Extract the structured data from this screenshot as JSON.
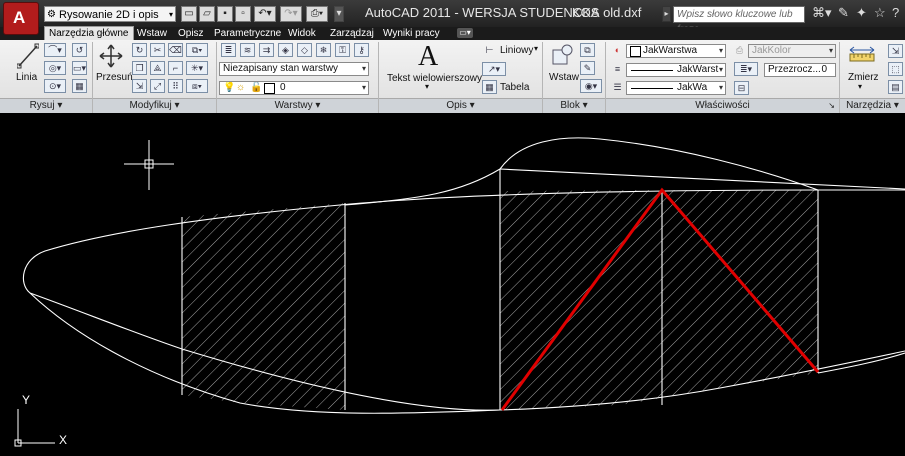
{
  "title": {
    "app": "AutoCAD 2011 - WERSJA STUDENCKA",
    "file": "KOS old.dxf"
  },
  "workspace": {
    "value": "Rysowanie 2D i opis"
  },
  "search": {
    "placeholder": "Wpisz słowo kluczowe lub frazę"
  },
  "tabs": [
    "Narzędzia główne",
    "Wstaw",
    "Opisz",
    "Parametryczne",
    "Widok",
    "Zarządzaj",
    "Wyniki pracy"
  ],
  "ribbon": {
    "draw": {
      "label": "Rysuj",
      "line_label": "Linia"
    },
    "modify": {
      "label": "Modyfikuj",
      "move_label": "Przesuń"
    },
    "layers": {
      "label": "Warstwy",
      "layer_state": "Niezapisany stan warstwy",
      "current_layer": "0"
    },
    "annotation": {
      "label": "Opis",
      "mtext_label": "Tekst wielowierszowy",
      "linear_label": "Liniowy",
      "table_label": "Tabela"
    },
    "block": {
      "label": "Blok",
      "insert_label": "Wstaw"
    },
    "properties": {
      "label": "Właściwości",
      "color": "JakWarstwa",
      "linetype": "JakWarst",
      "lineweight": "JakWa",
      "plotstyle": "JakKolor",
      "transparency_label": "Przezrocz...",
      "transparency_value": "0"
    },
    "utilities": {
      "label": "Narzędzia",
      "measure_label": "Zmierz"
    }
  },
  "ucs": {
    "x_label": "X",
    "y_label": "Y"
  },
  "colors": {
    "accent_red": "#e00000",
    "drawing_line": "#ffffff",
    "background": "#000000"
  }
}
